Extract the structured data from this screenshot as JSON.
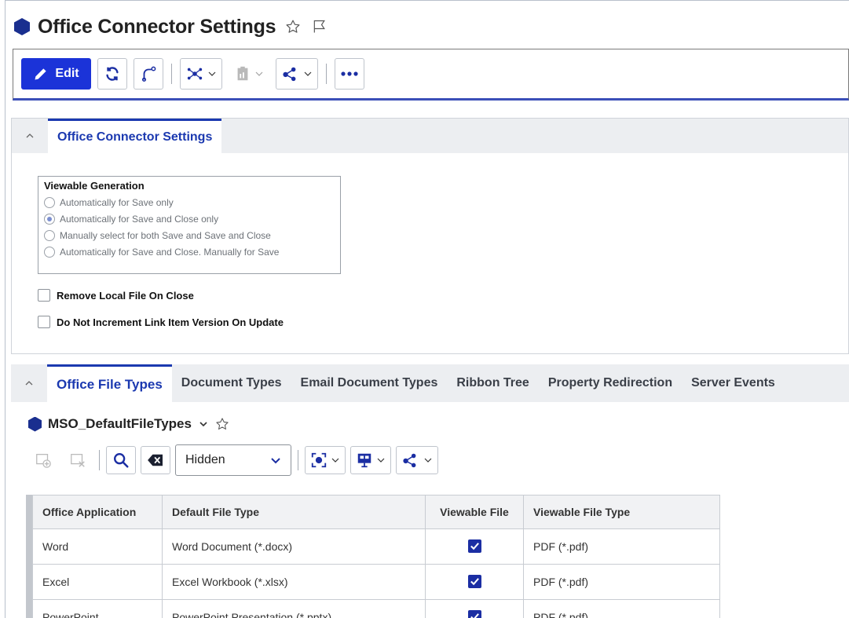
{
  "header": {
    "title": "Office Connector Settings",
    "favorite_icon": "star-outline-icon",
    "flag_icon": "flag-icon"
  },
  "toolbar": {
    "edit_label": "Edit",
    "buttons": [
      "refresh-icon",
      "promote-icon",
      "structure-icon",
      "report-icon",
      "share-icon",
      "more-icon"
    ]
  },
  "section1": {
    "tab_label": "Office Connector Settings",
    "viewable_generation": {
      "title": "Viewable Generation",
      "options": [
        "Automatically for Save only",
        "Automatically for Save and Close only",
        "Manually select for both Save and Save and Close",
        "Automatically for Save and Close. Manually for Save"
      ],
      "selected_index": 1
    },
    "remove_local_file_label": "Remove Local File On Close",
    "do_not_increment_label": "Do Not Increment Link Item Version On Update"
  },
  "section2": {
    "tabs": [
      "Office File Types",
      "Document Types",
      "Email Document Types",
      "Ribbon Tree",
      "Property Redirection",
      "Server Events"
    ],
    "active_tab": 0,
    "grid_name": "MSO_DefaultFileTypes",
    "select_value": "Hidden",
    "columns": [
      "Office Application",
      "Default File Type",
      "Viewable File",
      "Viewable File Type"
    ],
    "rows": [
      {
        "app": "Word",
        "default_type": "Word Document (*.docx)",
        "viewable": true,
        "viewable_type": "PDF (*.pdf)"
      },
      {
        "app": "Excel",
        "default_type": "Excel Workbook (*.xlsx)",
        "viewable": true,
        "viewable_type": "PDF (*.pdf)"
      },
      {
        "app": "PowerPoint",
        "default_type": "PowerPoint Presentation (*.pptx)",
        "viewable": true,
        "viewable_type": "PDF (*.pdf)"
      }
    ]
  },
  "colors": {
    "accent": "#1b33d8",
    "tab_active": "#1b39b0",
    "hexagon": "#1a2f8f"
  }
}
